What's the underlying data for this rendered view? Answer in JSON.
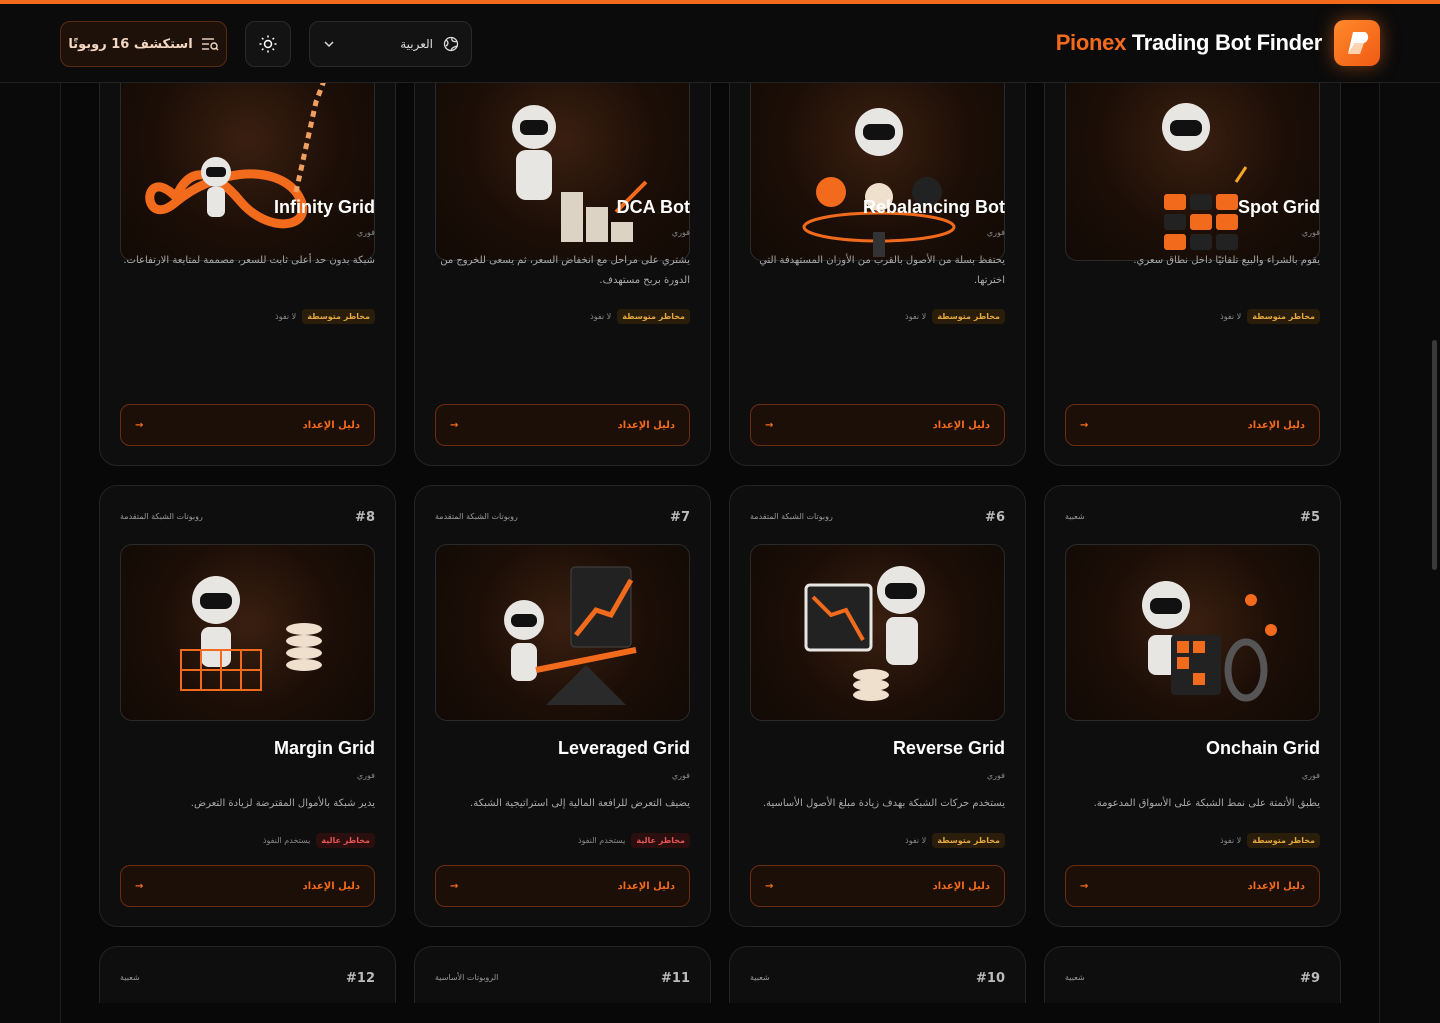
{
  "header": {
    "explore_label": "استكشف 16 روبوتًا",
    "language": "العربية",
    "brand_accent": "Pionex",
    "brand_rest": " Trading Bot Finder"
  },
  "colors": {
    "accent": "#f26b1d",
    "risk_medium": "#e3a73e",
    "risk_high": "#e55454"
  },
  "common": {
    "guide_label": "دليل الإعداد",
    "arrow": "→"
  },
  "row1": [
    {
      "name": "Infinity Grid",
      "type": "فوري",
      "desc": "شبكة بدون حد أعلى ثابت للسعر، مصممة لمتابعة الارتفاعات.",
      "risk": "مخاطر متوسطة",
      "lev": "لا نفوذ",
      "icon": "infinity-robot"
    },
    {
      "name": "DCA Bot",
      "type": "فوري",
      "desc": "يشتري على مراحل مع انخفاض السعر، ثم يسعى للخروج من الدورة بربح مستهدف.",
      "risk": "مخاطر متوسطة",
      "lev": "لا نفوذ",
      "icon": "dca-robot"
    },
    {
      "name": "Rebalancing Bot",
      "type": "فوري",
      "desc": "يحتفظ بسلة من الأصول بالقرب من الأوزان المستهدفة التي اخترتها.",
      "risk": "مخاطر متوسطة",
      "lev": "لا نفوذ",
      "icon": "rebalance-robot"
    },
    {
      "name": "Spot Grid",
      "type": "فوري",
      "desc": "يقوم بالشراء والبيع تلقائيًا داخل نطاق سعري.",
      "risk": "مخاطر متوسطة",
      "lev": "لا نفوذ",
      "icon": "grid-robot"
    }
  ],
  "row2": [
    {
      "rank": "#8",
      "cat": "روبوتات الشبكة المتقدمة",
      "name": "Margin Grid",
      "type": "فوري",
      "desc": "يدير شبكة بالأموال المقترضة لزيادة التعرض.",
      "risk": "مخاطر عالية",
      "lev": "يستخدم النفوذ",
      "icon": "margin-robot"
    },
    {
      "rank": "#7",
      "cat": "روبوتات الشبكة المتقدمة",
      "name": "Leveraged Grid",
      "type": "فوري",
      "desc": "يضيف التعرض للرافعة المالية إلى استراتيجية الشبكة.",
      "risk": "مخاطر عالية",
      "lev": "يستخدم النفوذ",
      "icon": "leverage-robot"
    },
    {
      "rank": "#6",
      "cat": "روبوتات الشبكة المتقدمة",
      "name": "Reverse Grid",
      "type": "فوري",
      "desc": "يستخدم حركات الشبكة بهدف زيادة مبلغ الأصول الأساسية.",
      "risk": "مخاطر متوسطة",
      "lev": "لا نفوذ",
      "icon": "reverse-robot"
    },
    {
      "rank": "#5",
      "cat": "شعبية",
      "name": "Onchain Grid",
      "type": "فوري",
      "desc": "يطبق الأتمتة على نمط الشبكة على الأسواق المدعومة.",
      "risk": "مخاطر متوسطة",
      "lev": "لا نفوذ",
      "icon": "onchain-robot"
    }
  ],
  "row3": [
    {
      "rank": "#12",
      "cat": "شعبية"
    },
    {
      "rank": "#11",
      "cat": "الروبوتات الأساسية"
    },
    {
      "rank": "#10",
      "cat": "شعبية"
    },
    {
      "rank": "#9",
      "cat": "شعبية"
    }
  ]
}
